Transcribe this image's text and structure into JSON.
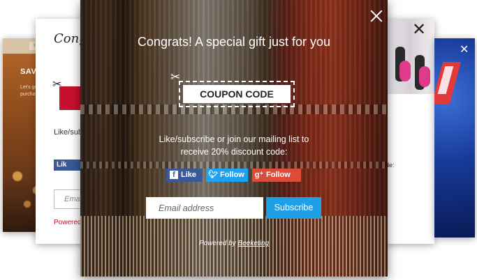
{
  "background_cards": {
    "far_left": {
      "label": "SAVE",
      "text": "Let's get purcha",
      "tab": "H"
    },
    "left": {
      "title": "Congr just f",
      "coupon_fragment": "C",
      "like_text": "Like/sub receive",
      "fb_label": "Lik",
      "email_placeholder": "Ema",
      "powered": "Powered"
    },
    "right": {
      "text": "de:"
    }
  },
  "popup": {
    "headline": "Congrats! A special gift just for you",
    "coupon_label": "COUPON CODE",
    "subtext": "Like/subscribe or join our mailing list to receive 20% discount code:",
    "social": {
      "facebook": "Like",
      "twitter": "Follow",
      "google": "Follow"
    },
    "email_placeholder": "Email address",
    "subscribe_label": "Subscribe",
    "powered_prefix": "Powered by ",
    "powered_brand": "Beeketing"
  },
  "colors": {
    "facebook": "#3b5998",
    "twitter": "#1da1f2",
    "google": "#dd4b39",
    "subscribe": "#1e9fe6",
    "accent_red": "#c8102e"
  },
  "icons": [
    "scissors-icon",
    "close-icon",
    "facebook-icon",
    "twitter-icon",
    "google-plus-icon"
  ]
}
